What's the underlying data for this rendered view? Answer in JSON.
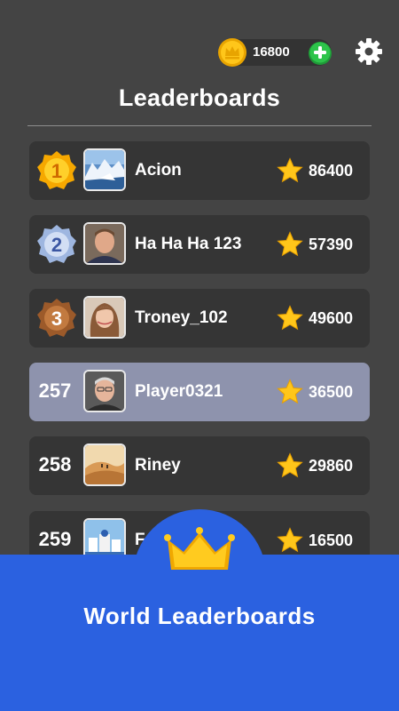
{
  "header": {
    "coins": "16800",
    "title": "Leaderboards"
  },
  "rows": [
    {
      "rank": "1",
      "name": "Acion",
      "score": "86400",
      "medal": "gold",
      "avatar": "glacier-photo"
    },
    {
      "rank": "2",
      "name": "Ha Ha Ha 123",
      "score": "57390",
      "medal": "silver",
      "avatar": "man-portrait"
    },
    {
      "rank": "3",
      "name": "Troney_102",
      "score": "49600",
      "medal": "bronze",
      "avatar": "woman-portrait"
    },
    {
      "rank": "257",
      "name": "Player0321",
      "score": "36500",
      "highlighted": true,
      "avatar": "older-man-portrait"
    },
    {
      "rank": "258",
      "name": "Riney",
      "score": "29860",
      "avatar": "desert-photo"
    },
    {
      "rank": "259",
      "name": "F",
      "score": "16500",
      "avatar": "town-photo"
    }
  ],
  "banner": {
    "text": "World Leaderboards"
  },
  "colors": {
    "background": "#444444",
    "row": "#353535",
    "row_highlight": "#8e93ad",
    "banner": "#2b61e0",
    "gold": "#f6b600",
    "add_green": "#2dc44a"
  }
}
